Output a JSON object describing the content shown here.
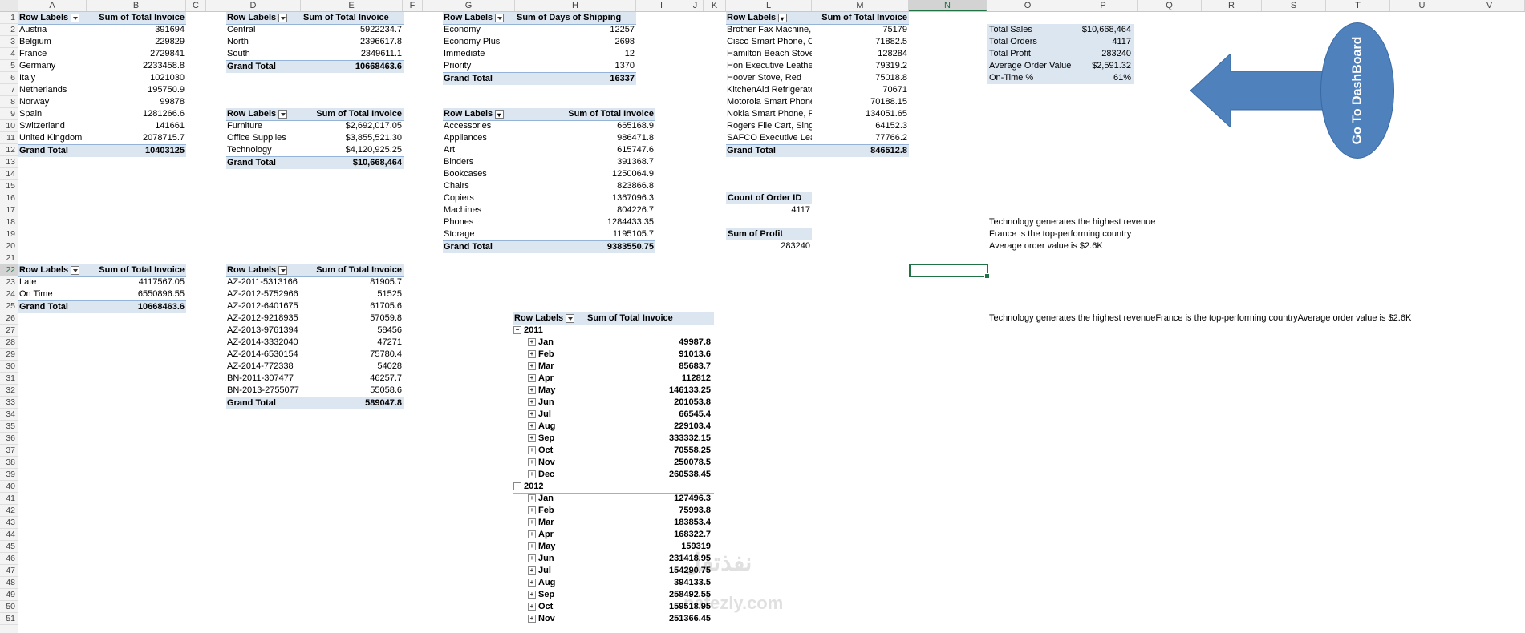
{
  "columns": [
    "A",
    "B",
    "C",
    "D",
    "E",
    "F",
    "G",
    "H",
    "I",
    "J",
    "K",
    "L",
    "M",
    "N",
    "O",
    "P",
    "Q",
    "R",
    "S",
    "T",
    "U",
    "V"
  ],
  "rows": [
    "1",
    "2",
    "3",
    "4",
    "5",
    "6",
    "7",
    "8",
    "9",
    "10",
    "11",
    "12",
    "13",
    "14",
    "15",
    "16",
    "17",
    "18",
    "19",
    "20",
    "21",
    "22",
    "23",
    "24",
    "25",
    "26",
    "27",
    "28",
    "29",
    "30",
    "31",
    "32",
    "33",
    "34",
    "35",
    "36",
    "37",
    "38",
    "39",
    "40",
    "41",
    "42",
    "43",
    "44",
    "45",
    "46",
    "47",
    "48",
    "49",
    "50",
    "51"
  ],
  "pivot_country": {
    "h1": "Row Labels",
    "h2": "Sum of Total Invoice",
    "items": [
      [
        "Austria",
        "391694"
      ],
      [
        "Belgium",
        "229829"
      ],
      [
        "France",
        "2729841"
      ],
      [
        "Germany",
        "2233458.8"
      ],
      [
        "Italy",
        "1021030"
      ],
      [
        "Netherlands",
        "195750.9"
      ],
      [
        "Norway",
        "99878"
      ],
      [
        "Spain",
        "1281266.6"
      ],
      [
        "Switzerland",
        "141661"
      ],
      [
        "United Kingdom",
        "2078715.7"
      ]
    ],
    "total_label": "Grand Total",
    "total": "10403125"
  },
  "pivot_region": {
    "h1": "Row Labels",
    "h2": "Sum of Total Invoice",
    "items": [
      [
        "Central",
        "5922234.7"
      ],
      [
        "North",
        "2396617.8"
      ],
      [
        "South",
        "2349611.1"
      ]
    ],
    "total_label": "Grand Total",
    "total": "10668463.6"
  },
  "pivot_category": {
    "h1": "Row Labels",
    "h2": "Sum of Total Invoice",
    "items": [
      [
        "Furniture",
        "$2,692,017.05"
      ],
      [
        "Office Supplies",
        "$3,855,521.30"
      ],
      [
        "Technology",
        "$4,120,925.25"
      ]
    ],
    "total_label": "Grand Total",
    "total": "$10,668,464"
  },
  "pivot_ontime": {
    "h1": "Row Labels",
    "h2": "Sum of Total Invoice",
    "items": [
      [
        "Late",
        "4117567.05"
      ],
      [
        "On Time",
        "6550896.55"
      ]
    ],
    "total_label": "Grand Total",
    "total": "10668463.6"
  },
  "pivot_orders": {
    "h1": "Row Labels",
    "h2": "Sum of Total Invoice",
    "items": [
      [
        "AZ-2011-5313166",
        "81905.7"
      ],
      [
        "AZ-2012-5752966",
        "51525"
      ],
      [
        "AZ-2012-6401675",
        "61705.6"
      ],
      [
        "AZ-2012-9218935",
        "57059.8"
      ],
      [
        "AZ-2013-9761394",
        "58456"
      ],
      [
        "AZ-2014-3332040",
        "47271"
      ],
      [
        "AZ-2014-6530154",
        "75780.4"
      ],
      [
        "AZ-2014-772338",
        "54028"
      ],
      [
        "BN-2011-307477",
        "46257.7"
      ],
      [
        "BN-2013-2755077",
        "55058.6"
      ]
    ],
    "total_label": "Grand Total",
    "total": "589047.8"
  },
  "pivot_shipping": {
    "h1": "Row Labels",
    "h2": "Sum of Days of Shipping",
    "items": [
      [
        "Economy",
        "12257"
      ],
      [
        "Economy Plus",
        "2698"
      ],
      [
        "Immediate",
        "12"
      ],
      [
        "Priority",
        "1370"
      ]
    ],
    "total_label": "Grand Total",
    "total": "16337"
  },
  "pivot_subcat": {
    "h1": "Row Labels",
    "h2": "Sum of Total Invoice",
    "items": [
      [
        "Accessories",
        "665168.9"
      ],
      [
        "Appliances",
        "986471.8"
      ],
      [
        "Art",
        "615747.6"
      ],
      [
        "Binders",
        "391368.7"
      ],
      [
        "Bookcases",
        "1250064.9"
      ],
      [
        "Chairs",
        "823866.8"
      ],
      [
        "Copiers",
        "1367096.3"
      ],
      [
        "Machines",
        "804226.7"
      ],
      [
        "Phones",
        "1284433.35"
      ],
      [
        "Storage",
        "1195105.7"
      ]
    ],
    "total_label": "Grand Total",
    "total": "9383550.75"
  },
  "pivot_product": {
    "h1": "Row Labels",
    "h2": "Sum of Total Invoice",
    "items": [
      [
        "Brother Fax Machine, Laser",
        "75179"
      ],
      [
        "Cisco Smart Phone, Cordless",
        "71882.5"
      ],
      [
        "Hamilton Beach Stove, Silver",
        "128284"
      ],
      [
        "Hon Executive Leather Armchair",
        "79319.2"
      ],
      [
        "Hoover Stove, Red",
        "75018.8"
      ],
      [
        "KitchenAid Refrigerator, Black",
        "70671"
      ],
      [
        "Motorola Smart Phone, Cordless",
        "70188.15"
      ],
      [
        "Nokia Smart Phone, Full Size",
        "134051.65"
      ],
      [
        "Rogers File Cart, Single Width",
        "64152.3"
      ],
      [
        "SAFCO Executive Leather Armchair",
        "77766.2"
      ]
    ],
    "total_label": "Grand Total",
    "total": "846512.8"
  },
  "count_orders": {
    "label": "Count of Order ID",
    "value": "4117"
  },
  "sum_profit": {
    "label": "Sum of Profit",
    "value": "283240"
  },
  "kpis": [
    [
      "Total Sales",
      "$10,668,464"
    ],
    [
      "Total Orders",
      "4117"
    ],
    [
      "Total Profit",
      "283240"
    ],
    [
      "Average Order Value",
      "$2,591.32"
    ],
    [
      "On-Time %",
      "61%"
    ]
  ],
  "insights": [
    "Technology generates the highest revenue",
    "France is the top-performing country",
    "Average order value is $2.6K"
  ],
  "insights_combined": "Technology generates the highest revenueFrance is the top-performing countryAverage order value is $2.6K",
  "pivot_month": {
    "h1": "Row Labels",
    "h2": "Sum of Total Invoice",
    "groups": [
      {
        "year": "2011",
        "months": [
          [
            "Jan",
            "49987.8"
          ],
          [
            "Feb",
            "91013.6"
          ],
          [
            "Mar",
            "85683.7"
          ],
          [
            "Apr",
            "112812"
          ],
          [
            "May",
            "146133.25"
          ],
          [
            "Jun",
            "201053.8"
          ],
          [
            "Jul",
            "66545.4"
          ],
          [
            "Aug",
            "229103.4"
          ],
          [
            "Sep",
            "333332.15"
          ],
          [
            "Oct",
            "70558.25"
          ],
          [
            "Nov",
            "250078.5"
          ],
          [
            "Dec",
            "260538.45"
          ]
        ]
      },
      {
        "year": "2012",
        "months": [
          [
            "Jan",
            "127496.3"
          ],
          [
            "Feb",
            "75993.8"
          ],
          [
            "Mar",
            "183853.4"
          ],
          [
            "Apr",
            "168322.7"
          ],
          [
            "May",
            "159319"
          ],
          [
            "Jun",
            "231418.95"
          ],
          [
            "Jul",
            "154290.75"
          ],
          [
            "Aug",
            "394133.5"
          ],
          [
            "Sep",
            "258492.55"
          ],
          [
            "Oct",
            "159518.95"
          ],
          [
            "Nov",
            "251366.45"
          ]
        ]
      }
    ]
  },
  "goto_button": "Go To DashBoard",
  "watermark": "نفذتقل",
  "watermark_url": "nafezly.com",
  "colors": {
    "pivot_header": "#dce6f1",
    "accent": "#4f81bd",
    "excel_green": "#217346"
  }
}
